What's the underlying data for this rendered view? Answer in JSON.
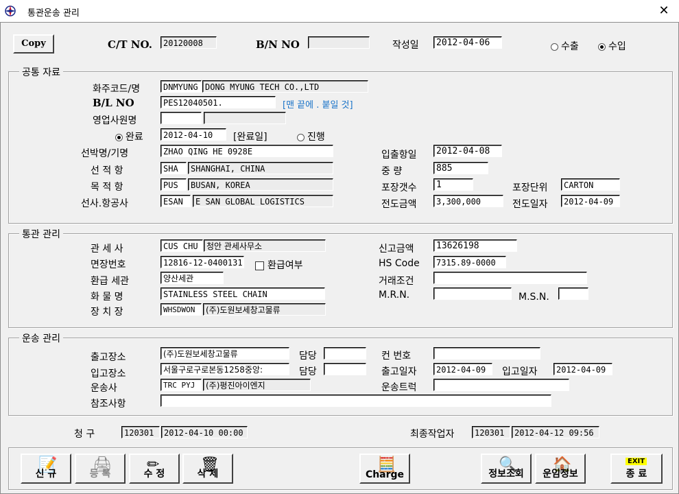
{
  "window": {
    "title": "통관운송 관리",
    "close": "✕"
  },
  "header": {
    "copy_label": "Copy",
    "ct_no_label": "C/T  NO.",
    "ct_no": "20120008",
    "bn_no_label": "B/N NO",
    "bn_no": "",
    "created_label": "작성일",
    "created": "2012-04-06",
    "export_label": "수출",
    "import_label": "수입",
    "mode_selected": "수입"
  },
  "common": {
    "title": "공통 자료",
    "shipper_label": "화주코드/명",
    "shipper_code": "DNMYUNG",
    "shipper_name": "DONG MYUNG TECH CO.,LTD",
    "bl_label": "B/L NO",
    "bl_no": "PES12040501.",
    "bl_hint": "[맨 끝에 . 붙일 것]",
    "sales_label": "영업사원명",
    "sales_code": "",
    "sales_name": "",
    "done_label": "완료",
    "done_date": "2012-04-10",
    "done_date_tag": "[완료일]",
    "progress_label": "진행",
    "vessel_label": "선박명/기명",
    "vessel": "ZHAO QING HE  0928E",
    "port_load_label": "선 적 항",
    "port_load_code": "SHA",
    "port_load_name": "SHANGHAI, CHINA",
    "port_dest_label": "목 적 항",
    "port_dest_code": "PUS",
    "port_dest_name": "BUSAN, KOREA",
    "carrier_label": "선사.항공사",
    "carrier_code": "ESAN",
    "carrier_name": "E SAN GLOBAL LOGISTICS",
    "arrival_label": "입출항일",
    "arrival": "2012-04-08",
    "weight_label": "중     량",
    "weight": "885",
    "packages_label": "포장갯수",
    "packages": "1",
    "pack_unit_label": "포장단위",
    "pack_unit": "CARTON",
    "amount_label": "전도금액",
    "amount": "3,300,000",
    "amount_date_label": "전도일자",
    "amount_date": "2012-04-09"
  },
  "customs": {
    "title": "통관 관리",
    "broker_label": "관 세 사",
    "broker_code": "CUS CHU",
    "broker_name": "청안 관세사무소",
    "license_label": "면장번호",
    "license": "12816-12-0400131",
    "refund_flag_label": "환급여부",
    "refund_office_label": "환급 세관",
    "refund_office": "양산세관",
    "goods_label": "화 물 명",
    "goods": "STAINLESS STEEL CHAIN",
    "storage_label": "장 치 장",
    "storage_code": "WHSDWON",
    "storage_name": "(주)도원보세창고물류",
    "declared_label": "신고금액",
    "declared": "13626198",
    "hs_label": "HS Code",
    "hs": "7315.89-0000",
    "terms_label": "거래조건",
    "terms": "",
    "mrn_label": "M.R.N.",
    "mrn": "",
    "msn_label": "M.S.N.",
    "msn": ""
  },
  "transport": {
    "title": "운송 관리",
    "out_place_label": "출고장소",
    "out_place": "(주)도원보세창고물류",
    "in_place_label": "입고장소",
    "in_place": "서울구로구로본동1258중앙:",
    "contact_label": "담당",
    "contact1": "",
    "contact2": "",
    "company_label": "운송사",
    "company_code": "TRC PYJ",
    "company_name": "(주)평진아이엔지",
    "notes_label": "참조사항",
    "notes": "",
    "container_label": "컨 번호",
    "container": "",
    "out_date_label": "출고일자",
    "out_date": "2012-04-09",
    "in_date_label": "입고일자",
    "in_date": "2012-04-09",
    "truck_label": "운송트럭",
    "truck": ""
  },
  "footer": {
    "claim_label": "청     구",
    "claim_user": "120301",
    "claim_time": "2012-04-10 00:00",
    "last_worker_label": "최종작업자",
    "last_user": "120301",
    "last_time": "2012-04-12 09:56"
  },
  "toolbar": {
    "new": "신 규",
    "register": "등  록",
    "edit": "수 정",
    "delete": "삭 제",
    "charge": "Charge",
    "info_query": "정보조회",
    "freight_info": "운임정보",
    "exit_badge": "EXIT",
    "exit": "종  료"
  },
  "colors": {
    "hint_text": "#1a73c8",
    "readonly_field": "#ececec",
    "exit_badge": "#ffff00"
  }
}
